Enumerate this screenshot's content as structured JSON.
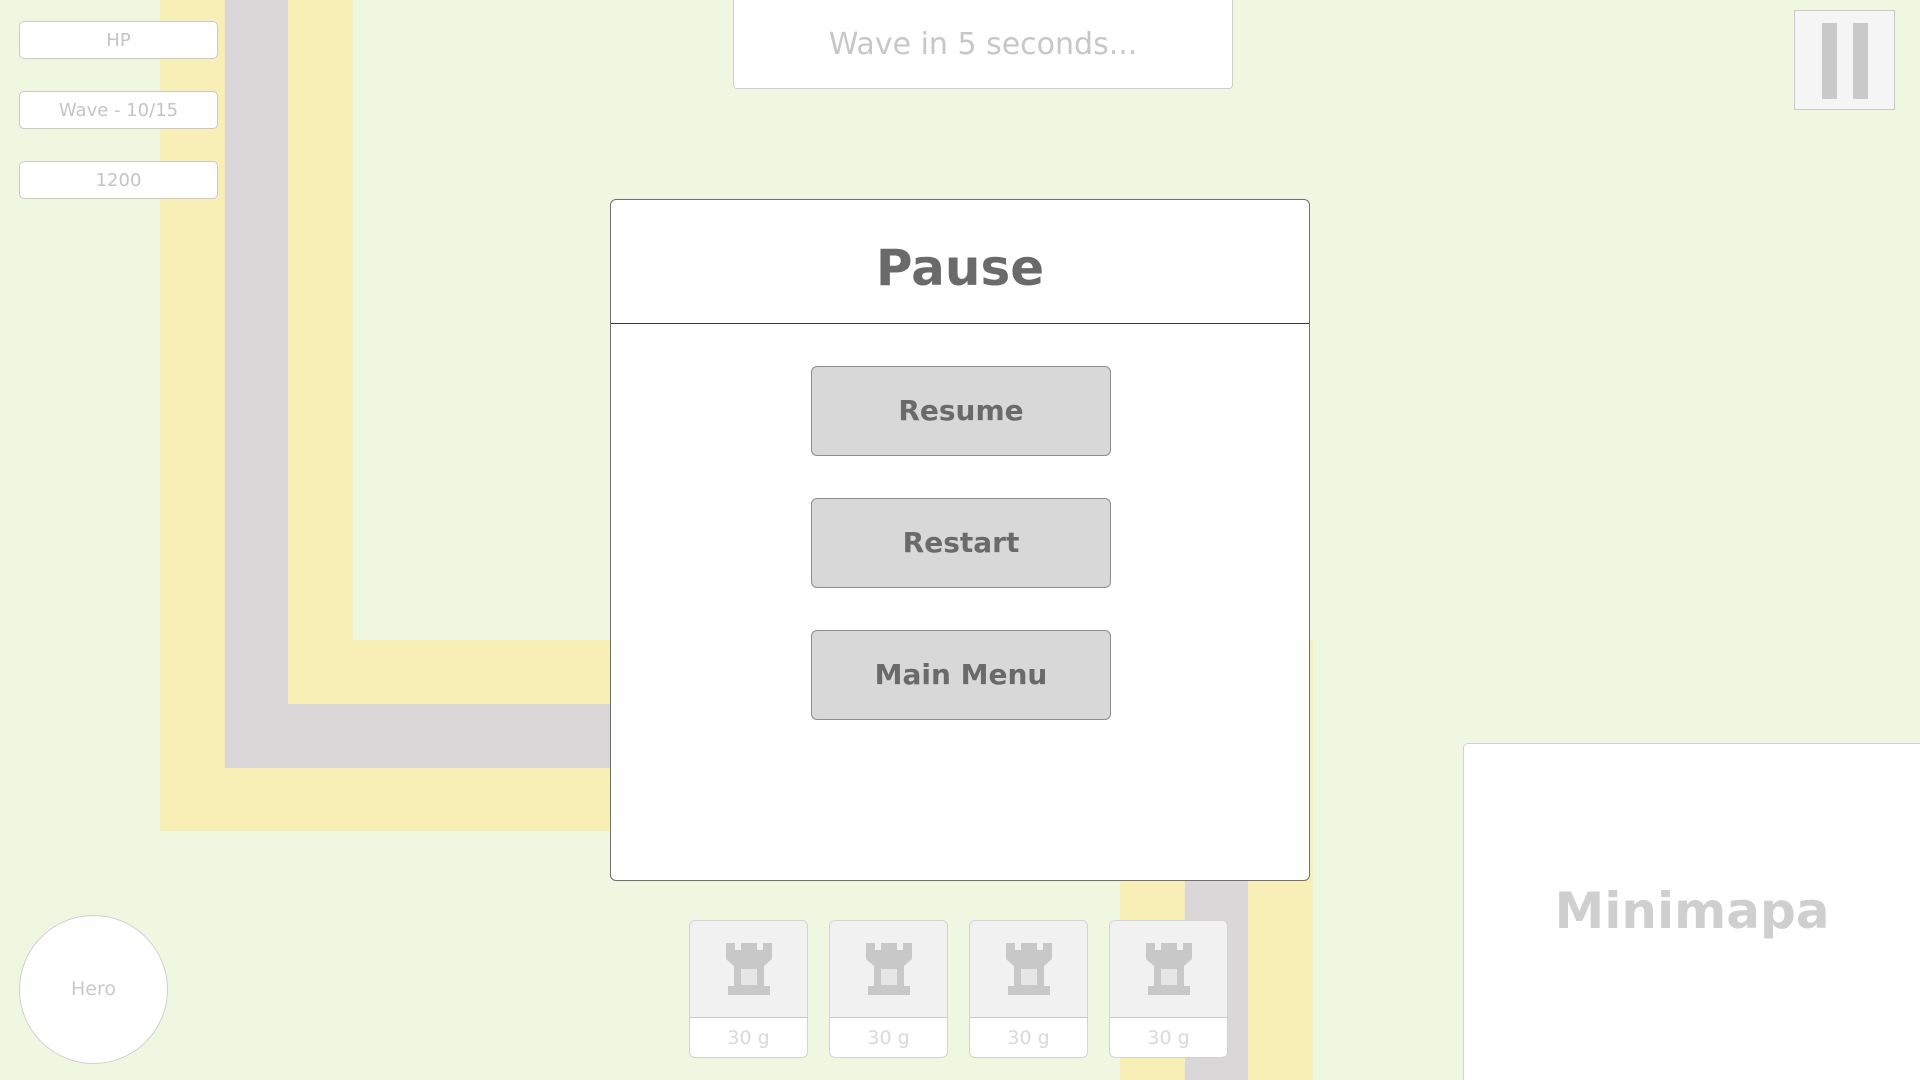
{
  "hud": {
    "hp_label": "HP",
    "wave_label": "Wave - 10/15",
    "gold": "1200"
  },
  "wave_banner": "Wave in 5 seconds...",
  "pause_icon": "pause-icon",
  "hero_label": "Hero",
  "minimap_label": "Minimapa",
  "tower_shop": [
    {
      "icon": "tower-icon",
      "price": "30 g"
    },
    {
      "icon": "tower-icon",
      "price": "30 g"
    },
    {
      "icon": "tower-icon",
      "price": "30 g"
    },
    {
      "icon": "tower-icon",
      "price": "30 g"
    }
  ],
  "pause_dialog": {
    "title": "Pause",
    "buttons": {
      "resume": "Resume",
      "restart": "Restart",
      "main_menu": "Main Menu"
    }
  },
  "colors": {
    "grass": "#eff7e1",
    "path_edge": "#f7efb6",
    "path_core": "#d9d7d8",
    "button": "#d8d8d8"
  }
}
